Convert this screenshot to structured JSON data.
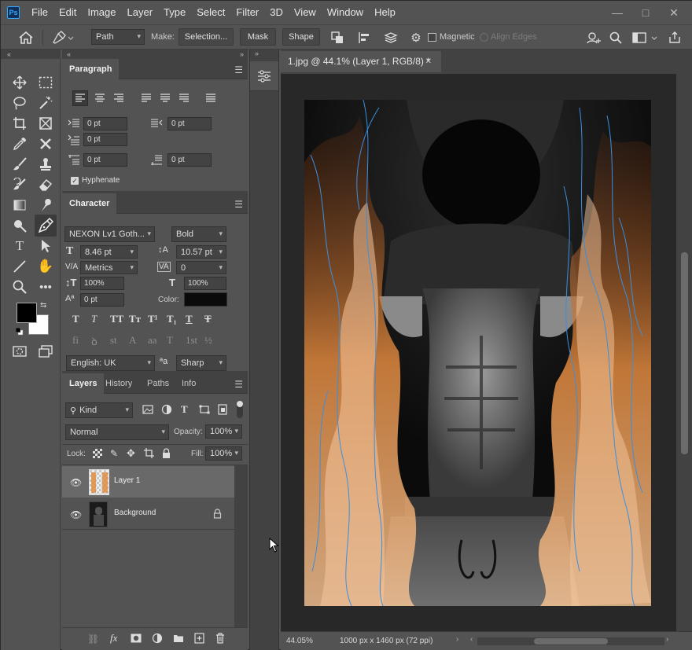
{
  "app": {
    "logo": "Ps"
  },
  "menu": [
    "File",
    "Edit",
    "Image",
    "Layer",
    "Type",
    "Select",
    "Filter",
    "3D",
    "View",
    "Window",
    "Help"
  ],
  "window_controls": {
    "minimize": "—",
    "maximize": "□",
    "close": "✕"
  },
  "options": {
    "mode": "Path",
    "make_label": "Make:",
    "selection_btn": "Selection...",
    "mask_btn": "Mask",
    "shape_btn": "Shape",
    "magnetic_label": "Magnetic",
    "align_edges_label": "Align Edges"
  },
  "paragraph": {
    "tab": "Paragraph",
    "indent_left": "0 pt",
    "indent_right": "0 pt",
    "indent_first": "0 pt",
    "space_before": "0 pt",
    "space_after": "0 pt",
    "hyphenate": "Hyphenate"
  },
  "character": {
    "tab": "Character",
    "font": "NEXON Lv1 Goth...",
    "style": "Bold",
    "size": "8.46 pt",
    "leading": "10.57 pt",
    "kerning": "Metrics",
    "tracking": "0",
    "vscale": "100%",
    "hscale": "100%",
    "baseline": "0 pt",
    "color_label": "Color:",
    "color": "#0a0a0a",
    "language": "English: UK",
    "aa_label": "ªa",
    "antialias": "Sharp",
    "type_btns": [
      "T",
      "T",
      "TT",
      "Tт",
      "T¹",
      "T₁",
      "T",
      "Ŧ"
    ],
    "opentype_btns": [
      "fi",
      "ꝺ",
      "st",
      "A",
      "aa",
      "T",
      "1st",
      "½"
    ]
  },
  "layers": {
    "tabs": [
      "Layers",
      "History",
      "Paths",
      "Info"
    ],
    "kind": "Kind",
    "blend": "Normal",
    "opacity_label": "Opacity:",
    "opacity": "100%",
    "lock_label": "Lock:",
    "fill_label": "Fill:",
    "fill": "100%",
    "items": [
      {
        "name": "Layer 1"
      },
      {
        "name": "Background"
      }
    ]
  },
  "document": {
    "tab": "1.jpg @ 44.1% (Layer 1, RGB/8) *",
    "close": "✕",
    "zoom": "44.05%",
    "info": "1000 px x 1460 px (72 ppi)"
  },
  "colors": {
    "foreground": "#000000",
    "background": "#ffffff",
    "accent": "#31a8ff"
  }
}
